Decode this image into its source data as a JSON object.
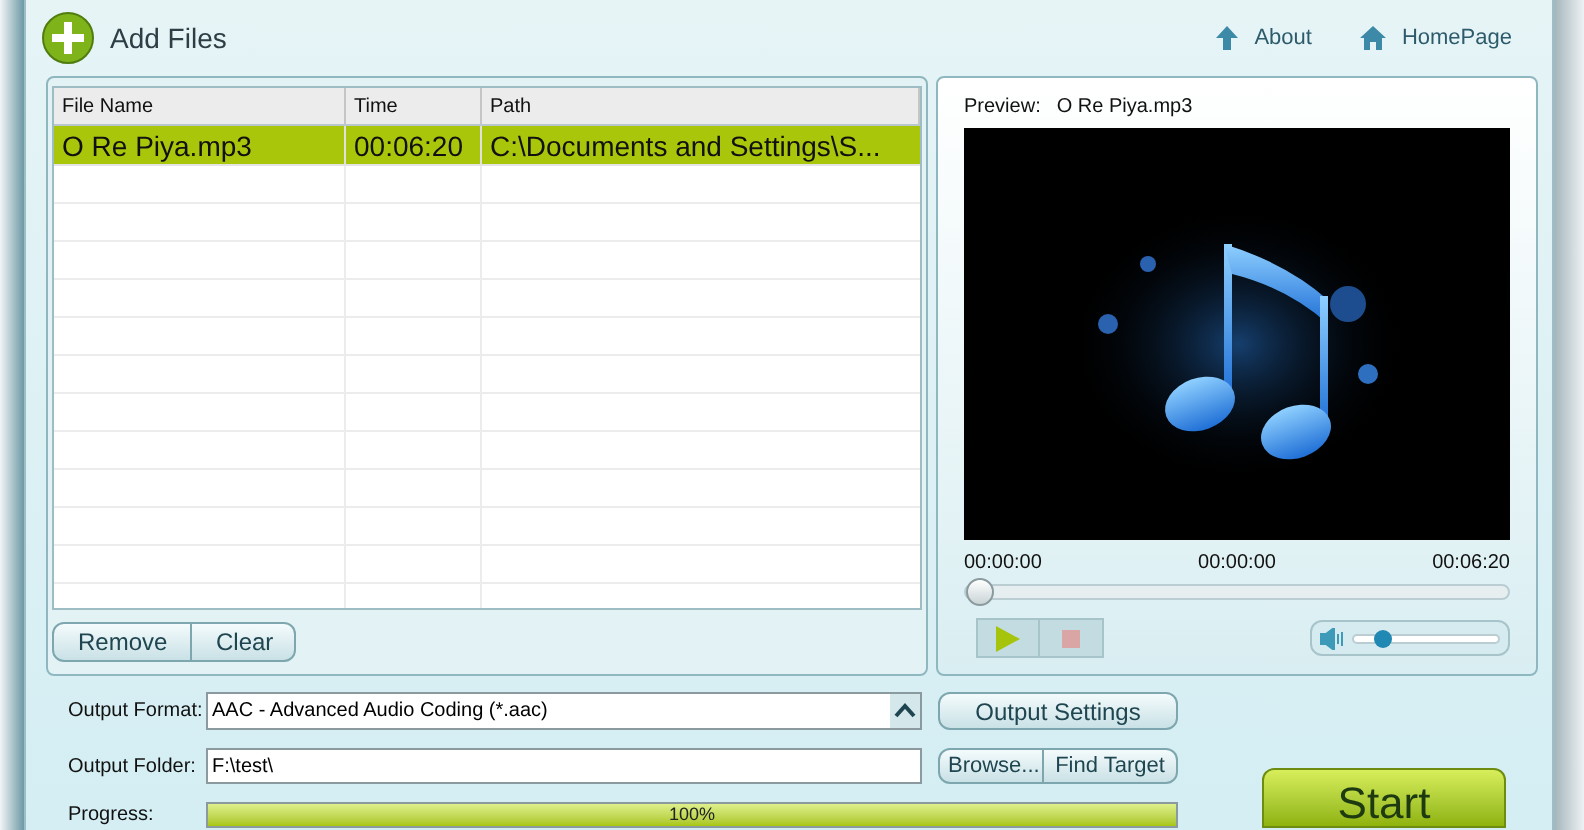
{
  "toolbar": {
    "add_files": "Add Files",
    "links": [
      {
        "kind": "about",
        "label": "About"
      },
      {
        "kind": "home",
        "label": "HomePage"
      }
    ]
  },
  "table": {
    "columns": [
      "File Name",
      "Time",
      "Path"
    ],
    "rows": [
      {
        "file_name": "O Re Piya.mp3",
        "time": "00:06:20",
        "path": "C:\\Documents and Settings\\S...",
        "selected": true
      }
    ]
  },
  "list_buttons": [
    "Remove",
    "Clear"
  ],
  "preview": {
    "label": "Preview:",
    "file": "O Re Piya.mp3",
    "times": [
      "00:00:00",
      "00:00:00",
      "00:06:20"
    ],
    "seek": {
      "level": 0
    },
    "volume": {
      "level": 0.2
    }
  },
  "output": {
    "format_label": "Output Format:",
    "format": "AAC - Advanced Audio Coding (*.aac)",
    "settings_button": "Output Settings",
    "folder_label": "Output Folder:",
    "folder": "F:\\test\\",
    "browse_button": "Browse...",
    "find_button": "Find Target",
    "progress_label": "Progress:",
    "progress": {
      "level": 1,
      "reading": "100%"
    },
    "start_button": "Start"
  }
}
